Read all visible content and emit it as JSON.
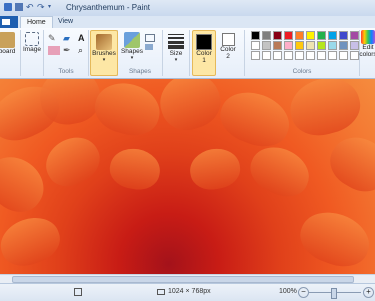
{
  "window": {
    "title": "Chrysanthemum - Paint"
  },
  "tabs": {
    "file": "",
    "home": "Home",
    "view": "View"
  },
  "groups": {
    "clipboard": {
      "label": "board"
    },
    "image": {
      "label": "Image"
    },
    "tools": {
      "label": "Tools"
    },
    "brushes": {
      "label": "Brushes"
    },
    "shapes": {
      "label": "Shapes"
    },
    "shapes_group": {
      "label": "Shapes"
    },
    "size": {
      "label": "Size"
    },
    "color1": {
      "label": "Color\n1"
    },
    "color2": {
      "label": "Color\n2"
    },
    "colors": {
      "label": "Colors"
    },
    "edit_colors": {
      "label": "Edit\ncolors"
    }
  },
  "palette_colors": [
    "#000000",
    "#7f7f7f",
    "#880015",
    "#ed1c24",
    "#ff7f27",
    "#fff200",
    "#22b14c",
    "#00a2e8",
    "#3f48cc",
    "#a349a4",
    "#ffffff",
    "#c3c3c3",
    "#b97a57",
    "#ffaec9",
    "#ffc90e",
    "#efe4b0",
    "#b5e61d",
    "#99d9ea",
    "#7092be",
    "#c8bfe7",
    "#ffffff",
    "#ffffff",
    "#ffffff",
    "#ffffff",
    "#ffffff",
    "#ffffff",
    "#ffffff",
    "#ffffff",
    "#ffffff",
    "#ffffff"
  ],
  "status": {
    "dimensions": "1024 × 768px",
    "zoom": "100%"
  }
}
